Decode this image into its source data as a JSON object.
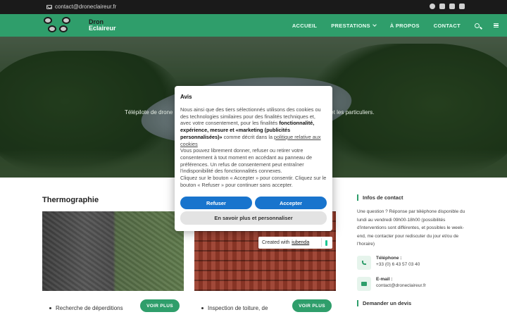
{
  "topbar": {
    "email": "contact@droneclaireur.fr",
    "socials": [
      "facebook-icon",
      "instagram-icon",
      "linkedin-icon",
      "youtube-icon"
    ]
  },
  "nav": {
    "logo_line1": "Dron",
    "logo_line2": "Eclaireur",
    "items": [
      {
        "label": "ACCUEIL"
      },
      {
        "label": "PRESTATIONS"
      },
      {
        "label": "À PROPOS"
      },
      {
        "label": "CONTACT"
      }
    ]
  },
  "hero": {
    "subtitle_left": "Télépilote de drone",
    "subtitle_right": "s et les particuliers."
  },
  "main": {
    "section_title": "Thermographie",
    "cards": [
      {
        "bullet": "Recherche de déperditions",
        "button": "VOIR PLUS"
      },
      {
        "bullet": "Inspection de toiture, de",
        "button": "VOIR PLUS"
      }
    ]
  },
  "sidebar": {
    "contact_title": "Infos de contact",
    "contact_text": "Une question ? Réponse par téléphone disponible du lundi au vendredi 09h00-18h00 (possibilités d'interventions sont différentes, et possibles le week-end, me contacter pour rediscuter du jour et/ou de l'horaire)",
    "phone_label": "Téléphone :",
    "phone_value": "+33 (0) 6 43 57 03 40",
    "email_label": "E-mail :",
    "email_value": "contact@droneclaireur.fr",
    "devis_title": "Demander un devis"
  },
  "consent": {
    "title": "Avis",
    "p1": "Nous ainsi que des tiers sélectionnés utilisons des cookies ou des technologies similaires pour des finalités techniques et, avec votre consentement, pour les finalités ",
    "p1_bold": "fonctionnalité, expérience, mesure et «marketing (publicités personnalisées)»",
    "p1_after": " comme décrit dans la ",
    "p1_link": "politique relative aux cookies",
    "p2": "Vous pouvez librement donner, refuser ou retirer votre consentement à tout moment en accédant au panneau de préférences. Un refus de consentement peut entraîner l'indisponibilité des fonctionnalités connexes.",
    "p3": "Cliquez sur le bouton « Accepter » pour consentir. Cliquez sur le bouton « Refuser » pour continuer sans accepter.",
    "refuse": "Refuser",
    "accept": "Accepter",
    "more": "En savoir plus et personnaliser"
  },
  "iubenda": {
    "created_with": "Created with",
    "brand": "iubenda"
  },
  "colors": {
    "brand_green": "#2f9e6b",
    "consent_blue": "#1874cd"
  }
}
